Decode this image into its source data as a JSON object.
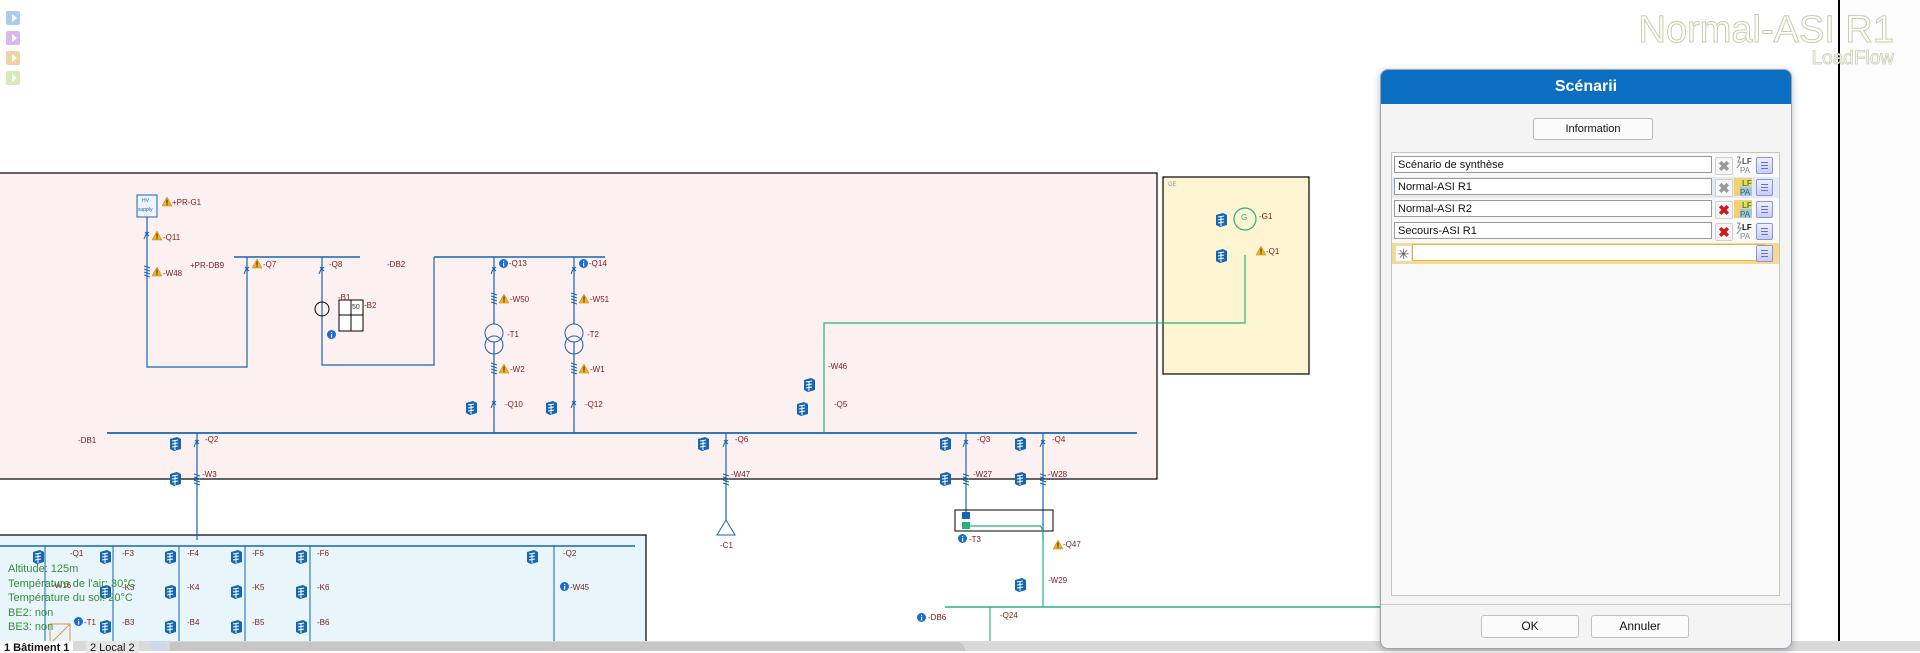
{
  "watermark": {
    "scenario": "Normal-ASI R1",
    "mode": "LoadFlow"
  },
  "side_toggles": [
    {
      "color": "#a9cdf0"
    },
    {
      "color": "#dcb6ee"
    },
    {
      "color": "#f0d2a8"
    },
    {
      "color": "#d6ecb8"
    }
  ],
  "diagram": {
    "zones": {
      "ge": "GE"
    },
    "hv_supply": {
      "line1": "HV",
      "line2": "supply"
    },
    "labels": {
      "pr_g1": "+PR-G1",
      "q11": "-Q11",
      "w48": "-W48",
      "pr_db9": "+PR-DB9",
      "q7": "-Q7",
      "q8": "-Q8",
      "db2": "-DB2",
      "b1": "-B1",
      "b2": "-B2",
      "b_val": "50",
      "q13": "-Q13",
      "q14": "-Q14",
      "w50": "-W50",
      "w51": "-W51",
      "t1": "-T1",
      "t2": "-T2",
      "w2": "-W2",
      "w1": "-W1",
      "q10": "-Q10",
      "q12": "-Q12",
      "db1": "-DB1",
      "q2": "-Q2",
      "w3": "-W3",
      "q6": "-Q6",
      "w47": "-W47",
      "c1": "-C1",
      "w46": "-W46",
      "q5": "-Q5",
      "q3": "-Q3",
      "q4": "-Q4",
      "w27": "-W27",
      "w28": "-W28",
      "t3": "-T3",
      "q47": "-Q47",
      "w29": "-W29",
      "db6": "-DB6",
      "q24": "-Q24",
      "g1": "-G1",
      "q1_ge": "-Q1",
      "g_symbol": "G",
      "b_q1": "-Q1",
      "f3": "-F3",
      "f4": "-F4",
      "f5": "-F5",
      "f6": "-F6",
      "b_q2": "-Q2",
      "k3": "-K3",
      "k4": "-K4",
      "k5": "-K5",
      "k6": "-K6",
      "b3": "-B3",
      "b4": "-B4",
      "b5": "-B5",
      "b6": "-B6",
      "w16": "-W16",
      "w45": "-W45",
      "bt1": "-T1"
    }
  },
  "environment": {
    "altitude": "Altitude: 125m",
    "air_temp": "Température de l'air: 30°C",
    "soil_temp": "Température du sol: 20°C",
    "be2": "BE2: non",
    "be3": "BE3: non"
  },
  "tabs": [
    {
      "label": "1 Bâtiment 1",
      "active": true
    },
    {
      "label": "2 Local 2",
      "active": false
    }
  ],
  "dialog": {
    "title": "Scénarii",
    "info_button": "Information",
    "scenarios": [
      {
        "name": "Scénario de synthèse",
        "deletable": false,
        "loadflow_active": false,
        "selected": false
      },
      {
        "name": "Normal-ASI R1",
        "deletable": false,
        "loadflow_active": true,
        "selected": true
      },
      {
        "name": "Normal-ASI R2",
        "deletable": true,
        "loadflow_active": true,
        "selected": false
      },
      {
        "name": "Secours-ASI R1",
        "deletable": true,
        "loadflow_active": false,
        "selected": false
      }
    ],
    "new_row": {
      "value": "",
      "marker": "✳"
    },
    "ok": "OK",
    "cancel": "Annuler"
  }
}
